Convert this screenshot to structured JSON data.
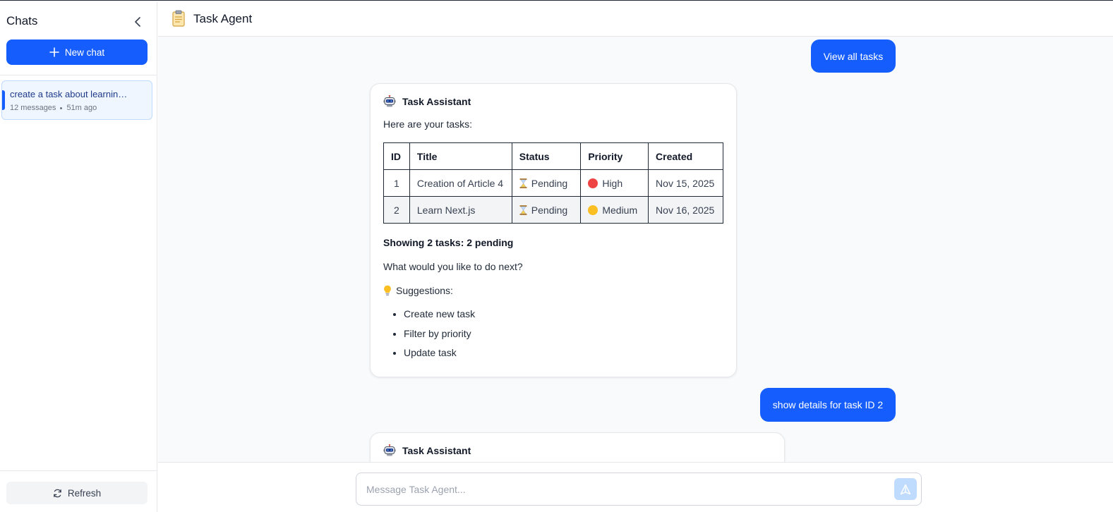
{
  "sidebar": {
    "title": "Chats",
    "new_chat_label": "New chat",
    "chats": [
      {
        "title": "create a task about learning Next.js",
        "message_count": "12 messages",
        "time": "51m ago",
        "active": true
      }
    ],
    "refresh_label": "Refresh"
  },
  "header": {
    "title": "Task Agent",
    "icon": "clipboard-icon"
  },
  "conversation": {
    "user_message_1": "View all tasks",
    "assistant_1": {
      "name": "Task Assistant",
      "intro": "Here are your tasks:",
      "table": {
        "headers": [
          "ID",
          "Title",
          "Status",
          "Priority",
          "Created"
        ],
        "rows": [
          {
            "id": "1",
            "title": "Creation of Article 4",
            "status": "Pending",
            "priority": "High",
            "priority_color": "#ef4444",
            "created": "Nov 15, 2025"
          },
          {
            "id": "2",
            "title": "Learn Next.js",
            "status": "Pending",
            "priority": "Medium",
            "priority_color": "#fbbf24",
            "created": "Nov 16, 2025"
          }
        ]
      },
      "summary": "Showing 2 tasks: 2 pending",
      "question": "What would you like to do next?",
      "suggestions_label": "Suggestions:",
      "suggestions": [
        "Create new task",
        "Filter by priority",
        "Update task"
      ]
    },
    "user_message_2": "show details for task ID 2",
    "assistant_2": {
      "name": "Task Assistant"
    }
  },
  "composer": {
    "placeholder": "Message Task Agent...",
    "value": ""
  },
  "colors": {
    "accent": "#155dfc",
    "high": "#ef4444",
    "medium": "#fbbf24"
  }
}
